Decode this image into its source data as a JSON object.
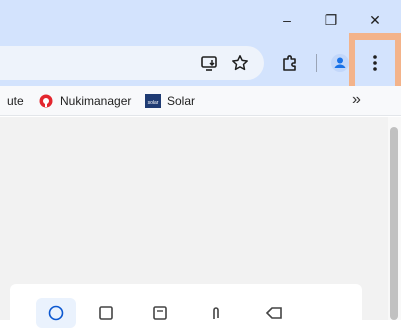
{
  "window": {
    "minimize_glyph": "–",
    "restore_glyph": "❐",
    "close_glyph": "✕"
  },
  "toolbar": {
    "icons": [
      "install-app-icon",
      "star-icon",
      "extensions-icon",
      "profile-icon",
      "more-menu-icon"
    ]
  },
  "bookmarks": {
    "items": [
      {
        "label": "ute",
        "icon": "none"
      },
      {
        "label": "Nukimanager",
        "icon": "nuki-icon"
      },
      {
        "label": "Solar",
        "icon": "solar-icon"
      }
    ],
    "solar_badge": "solar",
    "overflow_glyph": "»"
  },
  "colors": {
    "titlebar": "#d3e3fd",
    "highlight": "#f3b38a",
    "nuki_red": "#e3262e",
    "solar_navy": "#1f3b73",
    "profile_blue": "#1a73e8"
  }
}
